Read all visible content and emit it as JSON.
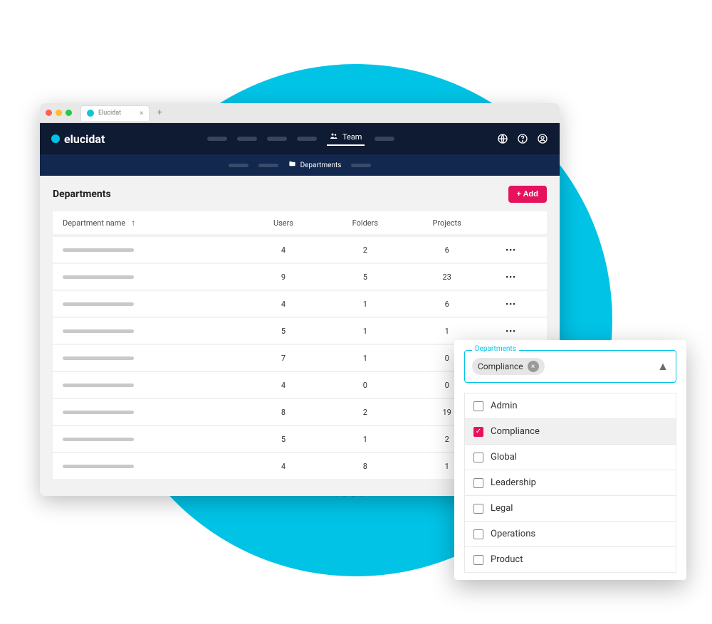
{
  "browser": {
    "tab_title": "Elucidat"
  },
  "brand": {
    "name": "elucidat"
  },
  "nav": {
    "active_label": "Team"
  },
  "subnav": {
    "active_label": "Departments"
  },
  "header_icons": [
    "globe-icon",
    "help-icon",
    "account-icon"
  ],
  "page": {
    "title": "Departments",
    "add_button": "+ Add"
  },
  "table": {
    "columns": [
      "Department name",
      "Users",
      "Folders",
      "Projects"
    ],
    "sort_arrow": "↑",
    "rows": [
      {
        "users": 4,
        "folders": 2,
        "projects": 6
      },
      {
        "users": 9,
        "folders": 5,
        "projects": 23
      },
      {
        "users": 4,
        "folders": 1,
        "projects": 6
      },
      {
        "users": 5,
        "folders": 1,
        "projects": 1
      },
      {
        "users": 7,
        "folders": 1,
        "projects": 0
      },
      {
        "users": 4,
        "folders": 0,
        "projects": 0
      },
      {
        "users": 8,
        "folders": 2,
        "projects": 19
      },
      {
        "users": 5,
        "folders": 1,
        "projects": 2
      },
      {
        "users": 4,
        "folders": 8,
        "projects": 1
      }
    ]
  },
  "dropdown": {
    "label": "Departments",
    "selected_chip": "Compliance",
    "options": [
      {
        "label": "Admin",
        "checked": false
      },
      {
        "label": "Compliance",
        "checked": true
      },
      {
        "label": "Global",
        "checked": false
      },
      {
        "label": "Leadership",
        "checked": false
      },
      {
        "label": "Legal",
        "checked": false
      },
      {
        "label": "Operations",
        "checked": false
      },
      {
        "label": "Product",
        "checked": false
      }
    ]
  },
  "colors": {
    "accent": "#e6125e",
    "brand_cyan": "#00c3e6",
    "navy": "#0f1a33"
  }
}
